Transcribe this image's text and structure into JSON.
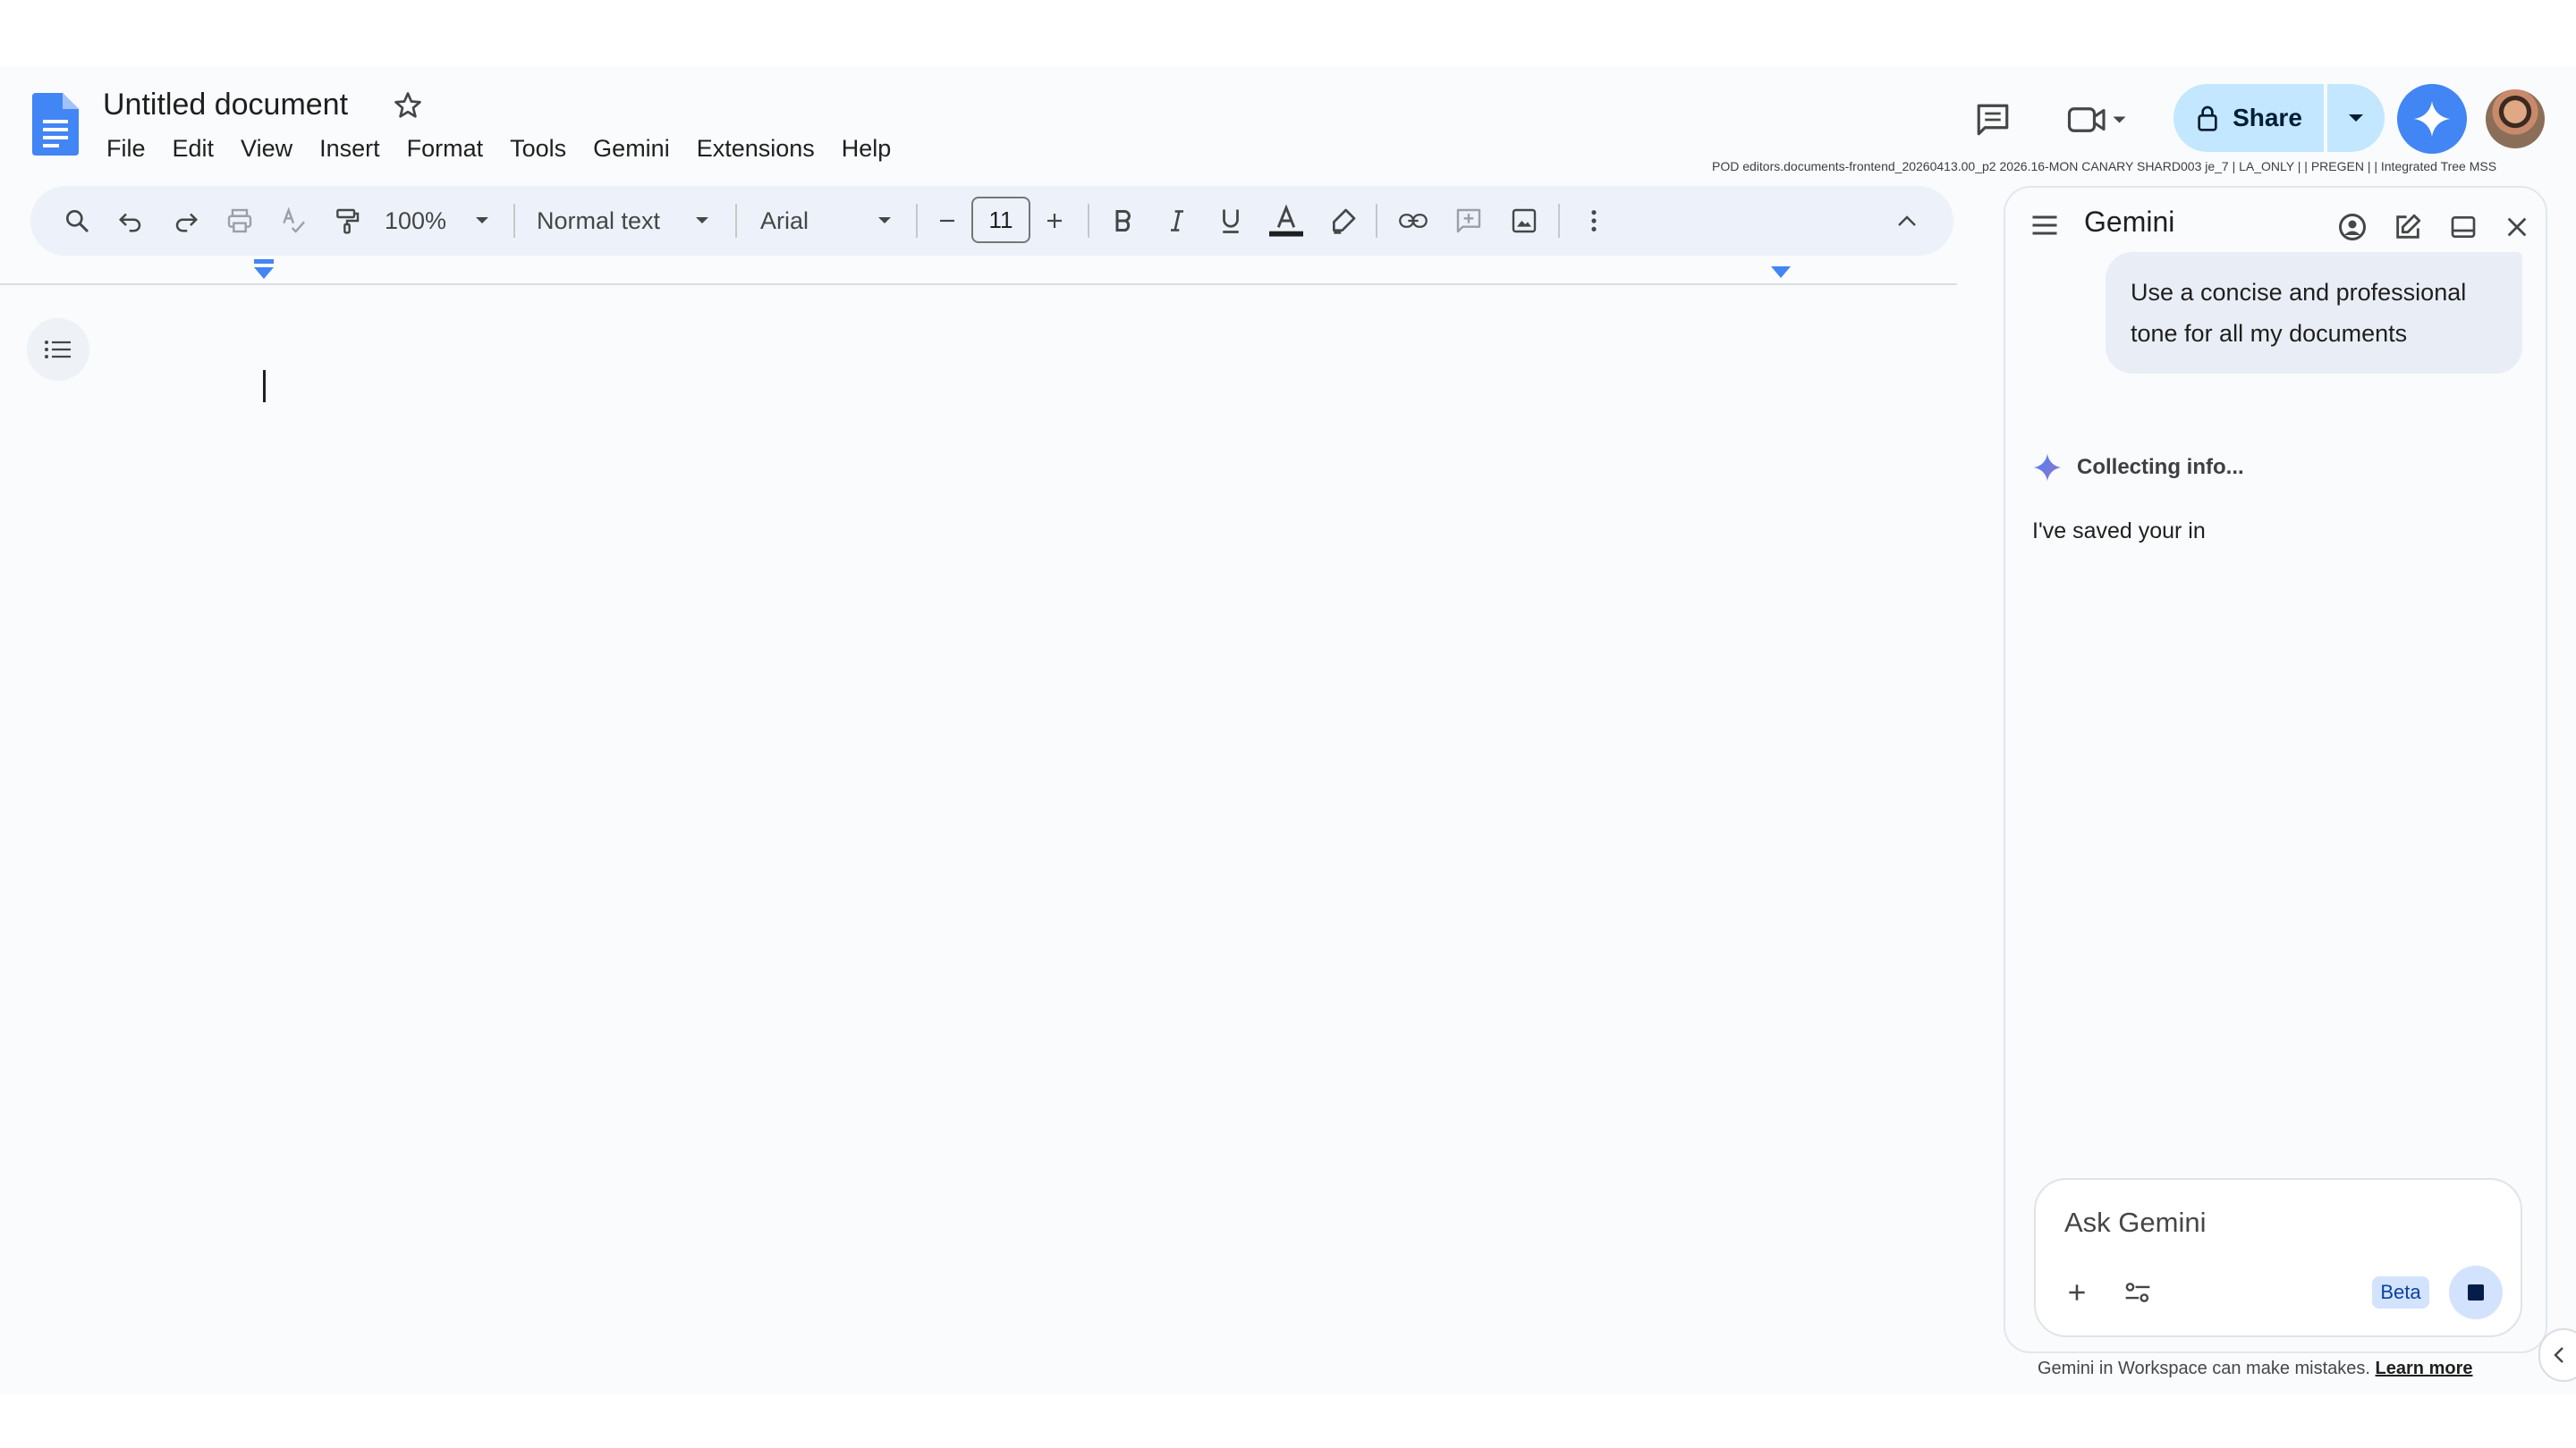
{
  "header": {
    "doc_title": "Untitled document",
    "menu": [
      "File",
      "Edit",
      "View",
      "Insert",
      "Format",
      "Tools",
      "Gemini",
      "Extensions",
      "Help"
    ],
    "share_label": "Share",
    "build_info": "POD editors.documents-frontend_20260413.00_p2 2026.16-MON CANARY SHARD003 je_7 | LA_ONLY | | PREGEN | | Integrated Tree  MSS"
  },
  "toolbar": {
    "zoom": "100%",
    "style": "Normal text",
    "font": "Arial",
    "font_size": "11"
  },
  "gemini": {
    "title": "Gemini",
    "user_message": "Use a concise and professional tone for all my documents",
    "status": "Collecting info...",
    "reply": "I've saved your in",
    "input_placeholder": "Ask Gemini",
    "beta_label": "Beta",
    "disclaimer": "Gemini in Workspace can make mistakes.",
    "learn_more": "Learn more"
  },
  "colors": {
    "accent": "#0b57d0",
    "share_bg": "#c2e7ff",
    "gemini_blue": "#4285f4",
    "docs_blue": "#4285f4"
  }
}
